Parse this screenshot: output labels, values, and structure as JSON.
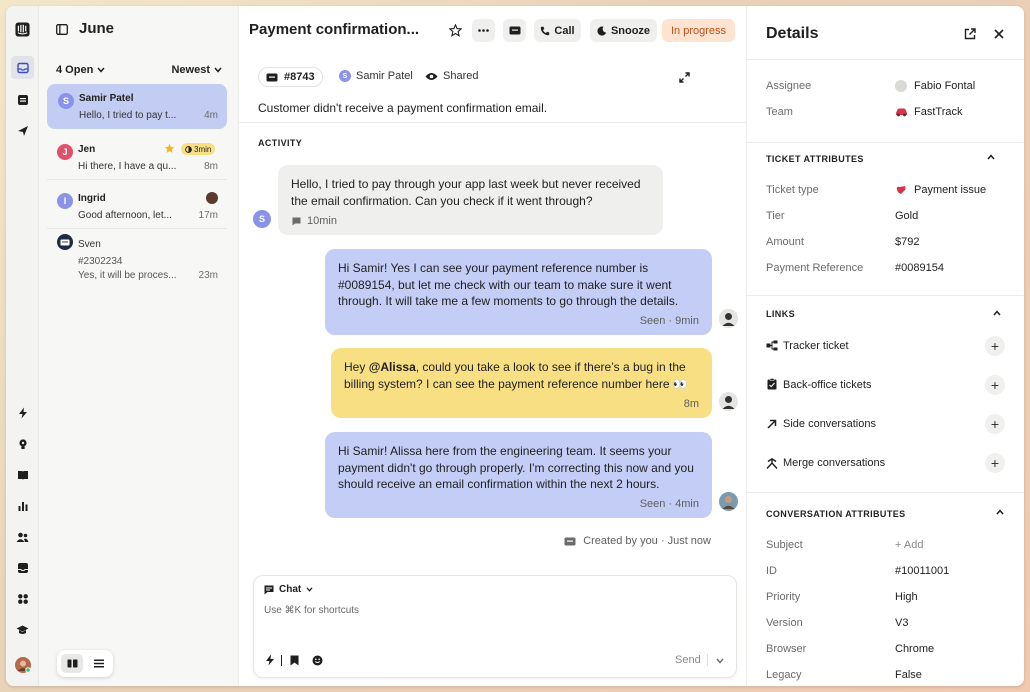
{
  "inbox": {
    "title": "June",
    "filter": "4 Open",
    "sort": "Newest",
    "conversations": [
      {
        "name": "Samir Patel",
        "initial": "S",
        "preview": "Hello, I tried to pay t...",
        "time": "4m",
        "color": "#8a93e8"
      },
      {
        "name": "Jen",
        "initial": "J",
        "preview": "Hi there, I have a qu...",
        "time": "8m",
        "color": "#e0506b",
        "badge": "3min"
      },
      {
        "name": "Ingrid",
        "initial": "I",
        "preview": "Good afternoon, let...",
        "time": "17m",
        "color": "#8a93e8"
      },
      {
        "name": "Sven",
        "ticket": "#2302234",
        "preview": "Yes, it will be proces...",
        "time": "23m"
      }
    ]
  },
  "header": {
    "title": "Payment confirmation...",
    "call_label": "Call",
    "snooze_label": "Snooze",
    "status_label": "In progress",
    "ticket_id": "#8743",
    "customer": "Samir Patel",
    "customer_initial": "S",
    "shared_label": "Shared",
    "summary": "Customer didn't receive a payment confirmation email."
  },
  "activity": {
    "title": "ACTIVITY",
    "customer_message": {
      "text": "Hello, I tried to pay through your app last week but never received the email confirmation. Can you check if it went through?",
      "time": "10min",
      "initial": "S"
    },
    "reply1": {
      "text": "Hi Samir! Yes I can see your payment reference number is #0089154, but let me check with our team to make sure it went through. It will take me a few moments to go through the details.",
      "meta": "Seen · 9min"
    },
    "note": {
      "prefix": "Hey ",
      "mention": "@Alissa",
      "text": ", could you take a look to see if there’s a bug in the billing system? I can see the payment reference number here 👀",
      "meta": "8m"
    },
    "reply2": {
      "text": "Hi Samir! Alissa here from the engineering team. It seems your payment didn't go through properly. I'm correcting this now and you should receive an email confirmation within the next 2 hours.",
      "meta": "Seen · 4min"
    },
    "created": "Created by you · Just now"
  },
  "composer": {
    "mode": "Chat",
    "placeholder": "Use ⌘K for shortcuts",
    "send_label": "Send"
  },
  "details": {
    "title": "Details",
    "assignee_label": "Assignee",
    "assignee": "Fabio Fontal",
    "team_label": "Team",
    "team": "FastTrack",
    "ticket_attributes_title": "TICKET ATTRIBUTES",
    "ticket_attributes": [
      {
        "label": "Ticket type",
        "value": "Payment issue"
      },
      {
        "label": "Tier",
        "value": "Gold"
      },
      {
        "label": "Amount",
        "value": "$792"
      },
      {
        "label": "Payment Reference",
        "value": "#0089154"
      }
    ],
    "links_title": "LINKS",
    "links": [
      {
        "label": "Tracker ticket",
        "icon": "tracker-icon"
      },
      {
        "label": "Back-office tickets",
        "icon": "clipboard-icon"
      },
      {
        "label": "Side conversations",
        "icon": "arrow-up-right-icon"
      },
      {
        "label": "Merge conversations",
        "icon": "merge-icon"
      }
    ],
    "conversation_attributes_title": "CONVERSATION ATTRIBUTES",
    "conversation_attributes": [
      {
        "label": "Subject",
        "value": "+ Add"
      },
      {
        "label": "ID",
        "value": "#10011001"
      },
      {
        "label": "Priority",
        "value": "High"
      },
      {
        "label": "Version",
        "value": "V3"
      },
      {
        "label": "Browser",
        "value": "Chrome"
      },
      {
        "label": "Legacy",
        "value": "False"
      }
    ]
  },
  "colors": {
    "accent": "#c3ccf2",
    "note": "#f8df84",
    "status": "#fde3d0"
  }
}
